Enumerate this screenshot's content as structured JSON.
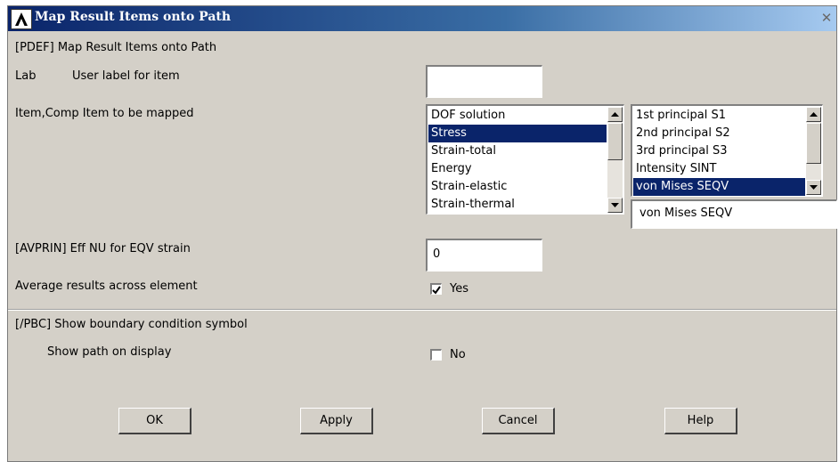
{
  "window": {
    "title": "Map Result Items onto Path",
    "close_glyph": "✕"
  },
  "section_pdef": {
    "heading": "[PDEF]  Map Result Items onto Path"
  },
  "lab": {
    "key": "Lab",
    "label": "User label for item",
    "value": ""
  },
  "item_comp": {
    "label": "Item,Comp  Item to be mapped",
    "items": [
      {
        "text": "DOF solution",
        "selected": false
      },
      {
        "text": "Stress",
        "selected": true
      },
      {
        "text": "Strain-total",
        "selected": false
      },
      {
        "text": "Energy",
        "selected": false
      },
      {
        "text": "Strain-elastic",
        "selected": false
      },
      {
        "text": "Strain-thermal",
        "selected": false
      }
    ],
    "components": [
      {
        "text": "1st principal S1",
        "selected": false
      },
      {
        "text": "2nd principal S2",
        "selected": false
      },
      {
        "text": "3rd principal S3",
        "selected": false
      },
      {
        "text": "Intensity   SINT",
        "selected": false
      },
      {
        "text": "von Mises   SEQV",
        "selected": true
      }
    ],
    "selected_component": "von Mises   SEQV"
  },
  "avprin": {
    "label": "[AVPRIN]  Eff NU for EQV strain",
    "value": "0"
  },
  "average": {
    "label": "Average results across element",
    "checked": true,
    "option_text": "Yes"
  },
  "pbc": {
    "heading": "[/PBC]  Show boundary condition symbol",
    "label": "Show path on display",
    "checked": false,
    "option_text": "No"
  },
  "buttons": {
    "ok": "OK",
    "apply": "Apply",
    "cancel": "Cancel",
    "help": "Help"
  },
  "icons": {
    "app": "ansys-logo-icon",
    "scroll_up": "arrow-up-icon",
    "scroll_down": "arrow-down-icon",
    "check": "checkmark-icon"
  },
  "colors": {
    "title_start": "#0a246a",
    "title_end": "#a6caf0",
    "dialog_bg": "#d4d0c8",
    "selection": "#0a246a"
  }
}
